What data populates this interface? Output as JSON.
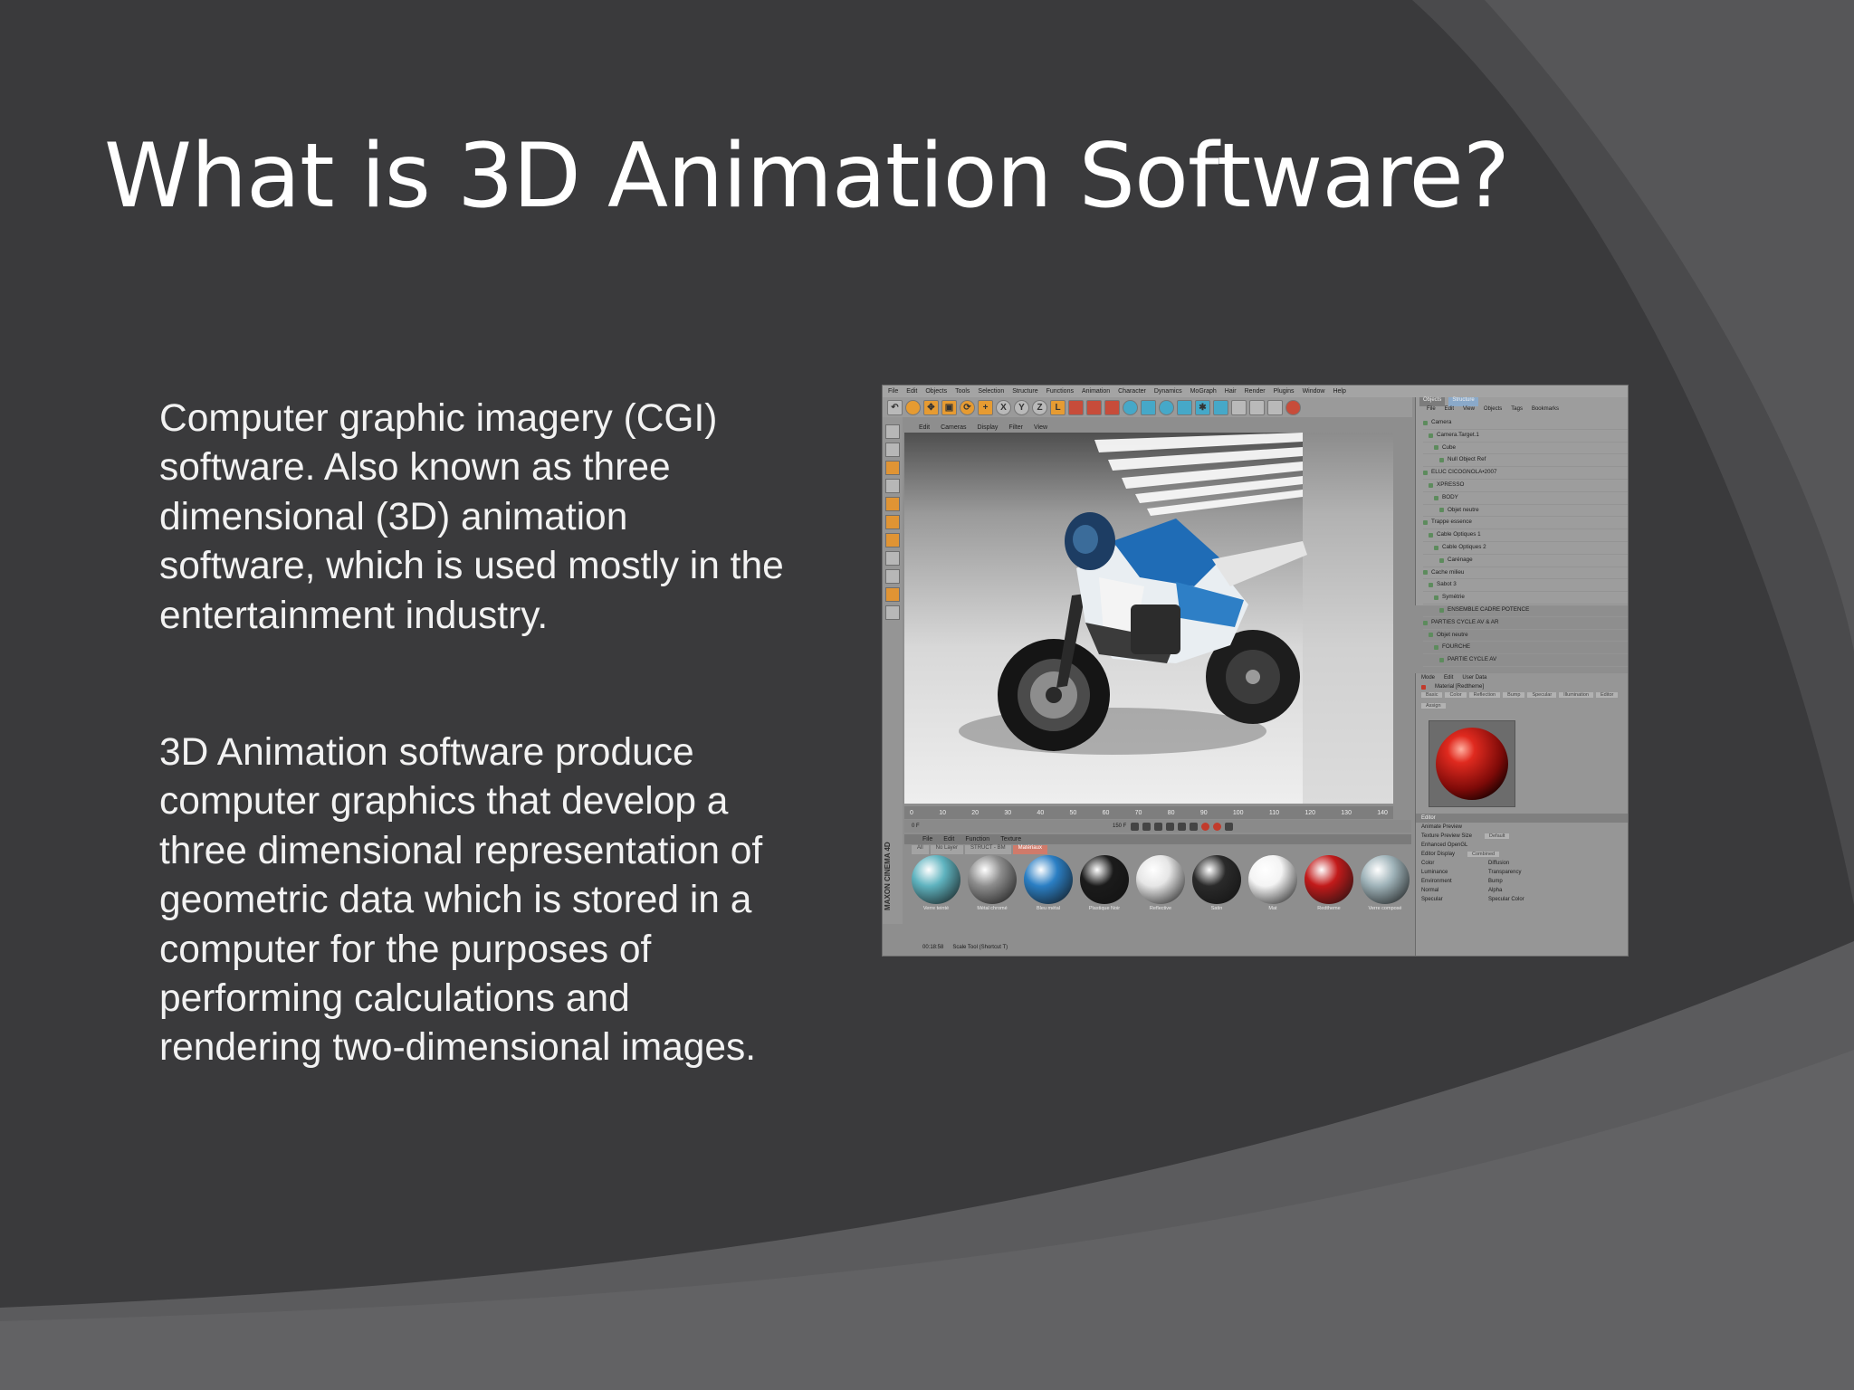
{
  "slide": {
    "title": "What is 3D Animation Software?",
    "paragraph_1": "Computer graphic imagery (CGI) software. Also known as three dimensional (3D) animation software, which is used mostly in the entertainment industry.",
    "paragraph_2": "3D Animation software produce computer graphics that develop a three dimensional representation of geometric data which is stored in a computer for the purposes of performing calculations and rendering two-dimensional images.",
    "background_color": "#3a3a3c",
    "text_color": "#ffffff"
  },
  "app_screenshot": {
    "menu": [
      "File",
      "Edit",
      "Objects",
      "Tools",
      "Selection",
      "Structure",
      "Functions",
      "Animation",
      "Character",
      "Dynamics",
      "MoGraph",
      "Hair",
      "Render",
      "Plugins",
      "Window",
      "Help"
    ],
    "viewport_menu": [
      "Edit",
      "Cameras",
      "Display",
      "Filter",
      "View"
    ],
    "timeline_ticks": [
      "0",
      "10",
      "20",
      "30",
      "40",
      "50",
      "60",
      "70",
      "80",
      "90",
      "100",
      "110",
      "120",
      "130",
      "140"
    ],
    "timeline_frame": "0 F",
    "timeline_end": "150 F",
    "material_menu": [
      "File",
      "Edit",
      "Function",
      "Texture"
    ],
    "material_tabs": [
      "All",
      "No Layer",
      "STRUCT - BM",
      "Matériaux"
    ],
    "materials": [
      {
        "label": "Verre teinté",
        "color": "#5fb3bf"
      },
      {
        "label": "Métal chromé",
        "color": "#8d8d8d"
      },
      {
        "label": "Bleu métal",
        "color": "#2b7fc4"
      },
      {
        "label": "Plastique Noir",
        "color": "#1b1b1b"
      },
      {
        "label": "Reflective",
        "color": "#e6e6e6"
      },
      {
        "label": "Satin",
        "color": "#2a2a2a"
      },
      {
        "label": "Mat",
        "color": "#f4f4f4"
      },
      {
        "label": "Redtheme",
        "color": "#c21a1a"
      },
      {
        "label": "Verre composé",
        "color": "#9fb3b9"
      }
    ],
    "status_text": "00:18:58",
    "status_hint": "Scale Tool (Shortcut T)",
    "brand_text": "MAXON CINEMA 4D",
    "object_tabs": [
      "Objects",
      "Structure"
    ],
    "object_menu": [
      "File",
      "Edit",
      "View",
      "Objects",
      "Tags",
      "Bookmarks"
    ],
    "objects": [
      "Camera",
      "Camera.Target.1",
      "Cube",
      "Null Object Ref",
      "ELUC CICOGNOLA•2007",
      "XPRESSO",
      "BODY",
      "Objet neutre",
      "Trappe essence",
      "Cable Optiques 1",
      "Cable Optiques 2",
      "Carénage",
      "Cache milieu",
      "Sabot 3",
      "Symétrie",
      "ENSEMBLE CADRE POTENCE",
      "PARTIES CYCLE AV & AR",
      "Objet neutre",
      "FOURCHE",
      "PARTIE CYCLE AV"
    ],
    "attr_menu": [
      "Mode",
      "Edit",
      "User Data"
    ],
    "attr_title": "Material [Redtheme]",
    "attr_tabs": [
      "Basic",
      "Color",
      "Reflection",
      "Bump",
      "Specular",
      "Illumination",
      "Editor",
      "Assign"
    ],
    "editor_heading": "Editor",
    "editor_rows": [
      {
        "left": "Animate Preview",
        "right": ""
      },
      {
        "left": "Texture Preview Size",
        "right": "Default"
      },
      {
        "left": "Enhanced OpenGL",
        "right": ""
      },
      {
        "left": "Editor Display",
        "right": "Combined"
      }
    ],
    "editor_channels": [
      [
        "Color",
        "Diffusion"
      ],
      [
        "Luminance",
        "Transparency"
      ],
      [
        "Environment",
        "Bump"
      ],
      [
        "Normal",
        "Alpha"
      ],
      [
        "Specular",
        "Specular Color"
      ]
    ]
  }
}
